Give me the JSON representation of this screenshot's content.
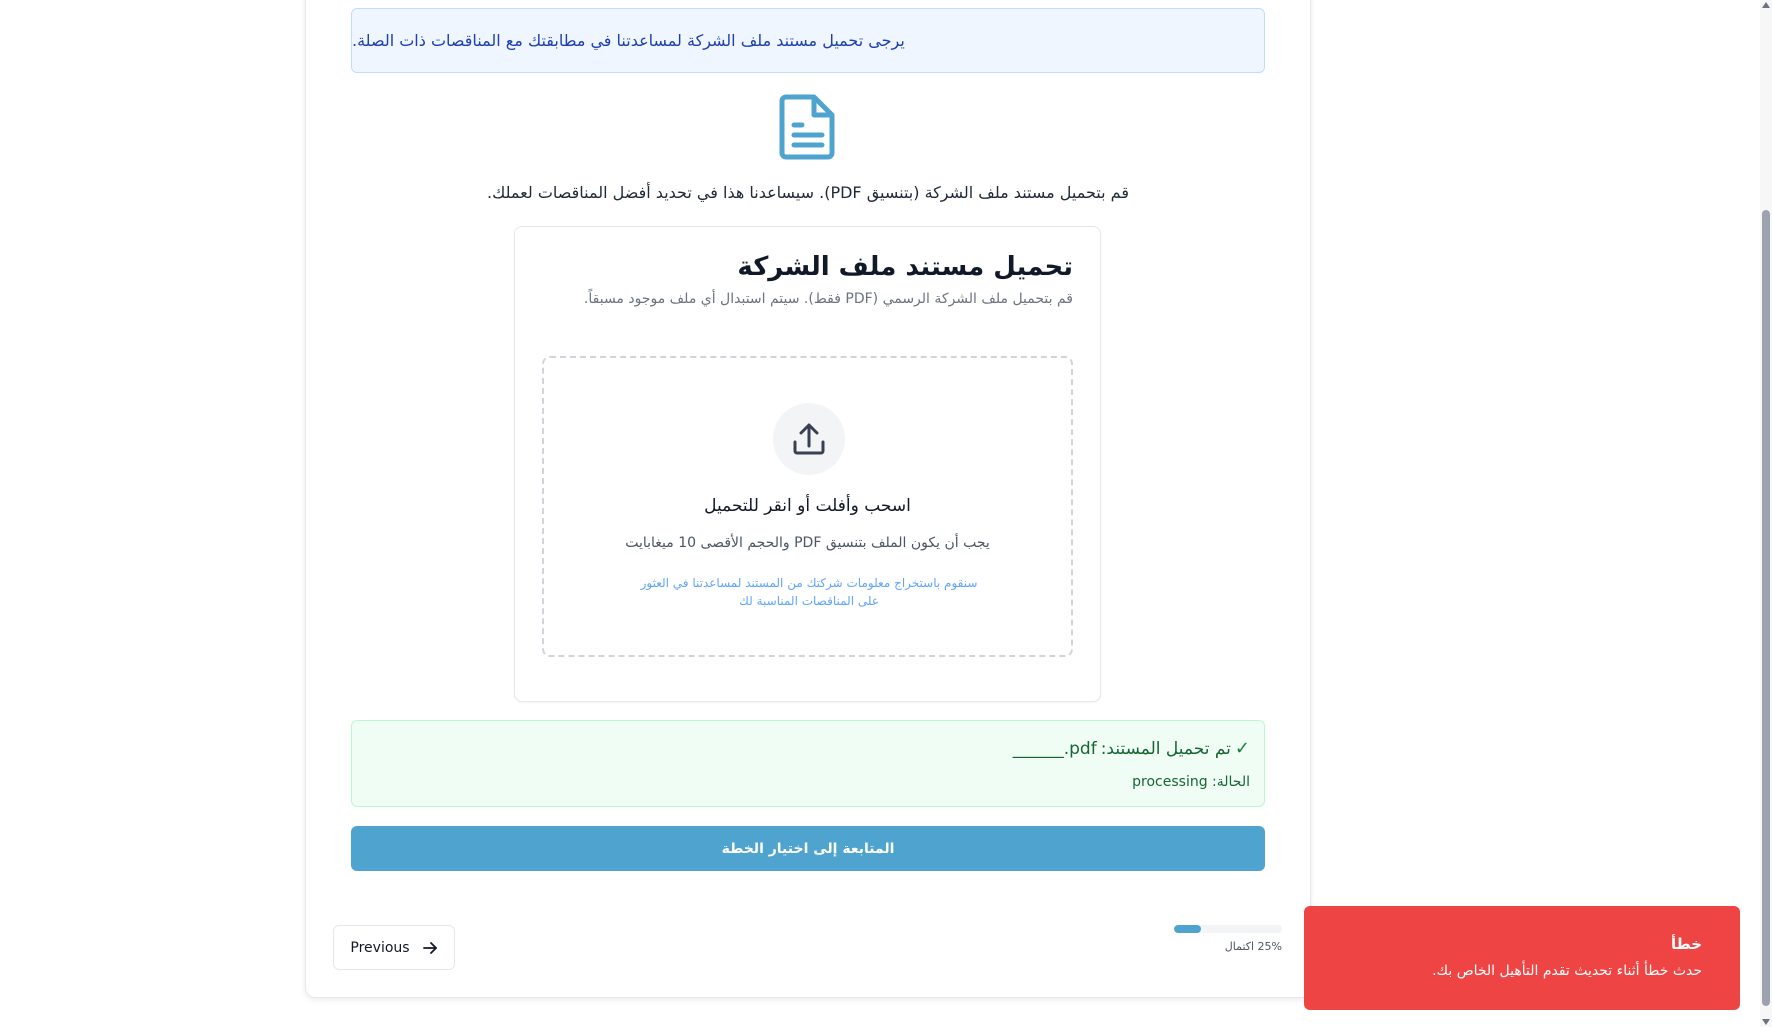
{
  "banner": {
    "text": "يرجى تحميل مستند ملف الشركة لمساعدتنا في مطابقتك مع المناقصات ذات الصلة."
  },
  "icons": {
    "document": "file-text-icon",
    "upload": "upload-icon",
    "check": "check-icon",
    "arrow": "arrow-right-icon"
  },
  "intro": {
    "text": "قم بتحميل مستند ملف الشركة (بتنسيق PDF). سيساعدنا هذا في تحديد أفضل المناقصات لعملك."
  },
  "upload": {
    "title": "تحميل مستند ملف الشركة",
    "subtitle": "قم بتحميل ملف الشركة الرسمي (PDF فقط). سيتم استبدال أي ملف موجود مسبقاً.",
    "drop_title": "اسحب وأفلت أو انقر للتحميل",
    "requirements": "يجب أن يكون الملف بتنسيق PDF والحجم الأقصى 10 ميغابايت",
    "note": "سنقوم باستخراج معلومات شركتك من المستند لمساعدتنا في العثور على المناقصات المناسبة لك"
  },
  "uploaded": {
    "label": "تم تحميل المستند:",
    "filename": "______.pdf",
    "status": "الحالة: processing"
  },
  "continue_label": "المتابعة إلى اختيار الخطة",
  "progress": {
    "value": 25,
    "label": "25% اكتمال"
  },
  "previous_label": "Previous",
  "toast": {
    "title": "خطأ",
    "message": "حدث خطأ أثناء تحديث تقدم التأهيل الخاص بك."
  },
  "colors": {
    "accent": "#4fa3cf",
    "error": "#ef4444",
    "success_bg": "#f0fdf4",
    "info_bg": "#eff6ff"
  }
}
